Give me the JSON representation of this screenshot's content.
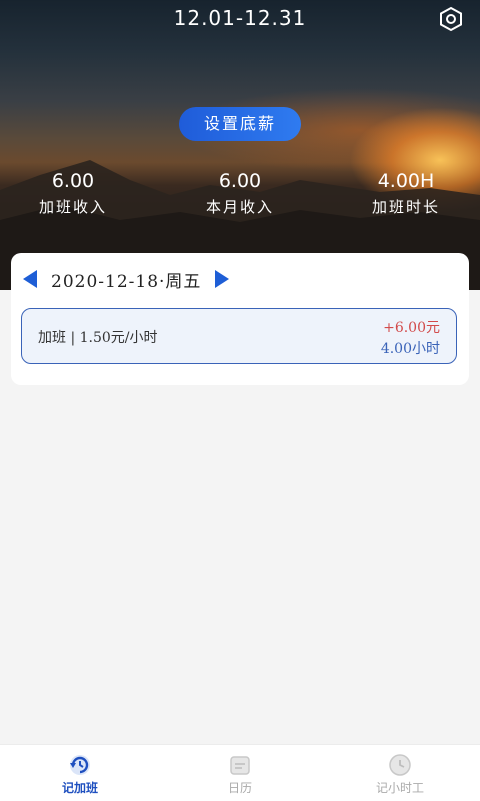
{
  "header": {
    "period": "12.01-12.31",
    "set_background_label": "设置底薪",
    "stats": [
      {
        "value": "6.00",
        "label": "加班收入"
      },
      {
        "value": "6.00",
        "label": "本月收入"
      },
      {
        "value": "4.00H",
        "label": "加班时长"
      }
    ]
  },
  "day": {
    "date_text": "2020-12-18·周五",
    "entries": [
      {
        "label": "加班 | 1.50元/小时",
        "amount": "+6.00元",
        "hours": "4.00小时"
      }
    ]
  },
  "tabs": [
    {
      "label": "记加班",
      "icon": "refresh-icon",
      "active": true
    },
    {
      "label": "日历",
      "icon": "calendar-icon",
      "active": false
    },
    {
      "label": "记小时工",
      "icon": "clock-icon",
      "active": false
    }
  ],
  "colors": {
    "accent": "#1e5ed6",
    "income": "#d24a4a",
    "hours": "#3a63b8"
  }
}
